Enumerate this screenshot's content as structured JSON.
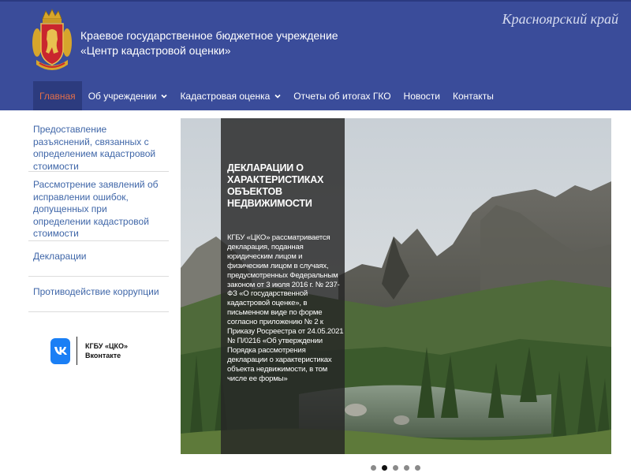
{
  "header": {
    "org_line1": "Краевое государственное бюджетное учреждение",
    "org_line2": "«Центр кадастровой оценки»",
    "region": "Красноярский край",
    "emblem_icon": "krasnoyarsk-coat-of-arms-icon"
  },
  "nav": {
    "items": [
      {
        "label": "Главная",
        "active": true
      },
      {
        "label": "Об учреждении",
        "dropdown": true
      },
      {
        "label": "Кадастровая оценка",
        "dropdown": true
      },
      {
        "label": "Отчеты об итогах ГКО"
      },
      {
        "label": "Новости"
      },
      {
        "label": "Контакты"
      }
    ]
  },
  "sidebar": {
    "items": [
      {
        "label": "Предоставление разъяснений, связанных с определением кадастровой стоимости"
      },
      {
        "label": "Рассмотрение заявлений об исправлении ошибок, допущенных при определении кадастровой стоимости"
      },
      {
        "label": "Декларации"
      },
      {
        "label": "Противодействие коррупции"
      }
    ],
    "vk": {
      "line1": "КГБУ «ЦКО»",
      "line2": "Вконтакте",
      "icon": "vk-icon"
    }
  },
  "slider": {
    "title": "ДЕКЛАРАЦИИ О ХАРАКТЕРИСТИКАХ ОБЪЕКТОВ НЕДВИЖИМОСТИ",
    "text": "КГБУ «ЦКО» рассматривается декларация, поданная юридическим лицом и физическим лицом в случаях, предусмотренных Федеральным законом от 3 июля 2016 г. № 237-ФЗ «О государственной кадастровой оценке», в письменном виде по форме согласно приложению № 2 к Приказу Росреестра от 24.05.2021 № П/0216 «Об утверждении Порядка рассмотрения декларации о характеристиках объекта недвижимости, в том числе ее формы»",
    "image": "mountain-lake-landscape",
    "dots": 5,
    "active_dot": 2
  },
  "colors": {
    "header_bg": "#3a4c9a",
    "nav_active_bg": "#2c3b7e",
    "nav_active_text": "#e36f4a",
    "sidebar_link": "#3f66a8",
    "vk_blue": "#1a7ff5"
  }
}
